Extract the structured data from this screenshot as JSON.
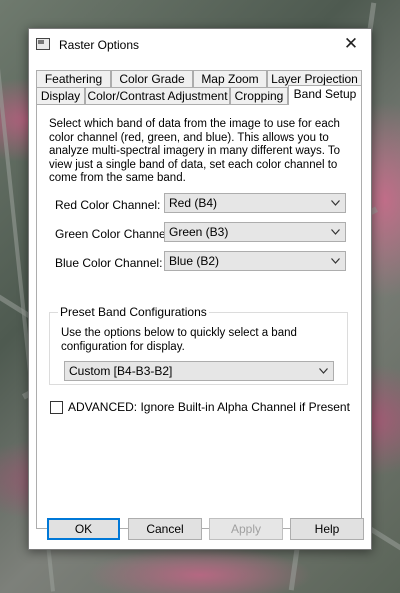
{
  "window": {
    "title": "Raster Options"
  },
  "tabs": {
    "row1": [
      "Feathering",
      "Color Grade",
      "Map Zoom",
      "Layer Projection"
    ],
    "row2": [
      "Display",
      "Color/Contrast Adjustment",
      "Cropping",
      "Band Setup"
    ],
    "active": "Band Setup"
  },
  "band_setup": {
    "description": "Select which band of data from the image to use for each color channel (red, green, and blue). This allows you to analyze multi-spectral imagery in many different ways. To view just a single band of data, set each color channel to come from the same band.",
    "channels": [
      {
        "label": "Red Color Channel:",
        "value": "Red (B4)"
      },
      {
        "label": "Green Color Channel:",
        "value": "Green (B3)"
      },
      {
        "label": "Blue Color Channel:",
        "value": "Blue (B2)"
      }
    ],
    "preset": {
      "title": "Preset Band Configurations",
      "description": "Use the options below to quickly select a band configuration for display.",
      "value": "Custom [B4-B3-B2]"
    },
    "advanced": {
      "label": "ADVANCED: Ignore Built-in Alpha Channel if Present",
      "checked": false
    }
  },
  "buttons": {
    "ok": "OK",
    "cancel": "Cancel",
    "apply": "Apply",
    "help": "Help"
  },
  "icons": {
    "close": "close-icon",
    "app": "window-icon",
    "dropdown": "chevron-down-icon"
  },
  "colors": {
    "focus": "#0078d7",
    "disabled_text": "#a0a0a0"
  }
}
